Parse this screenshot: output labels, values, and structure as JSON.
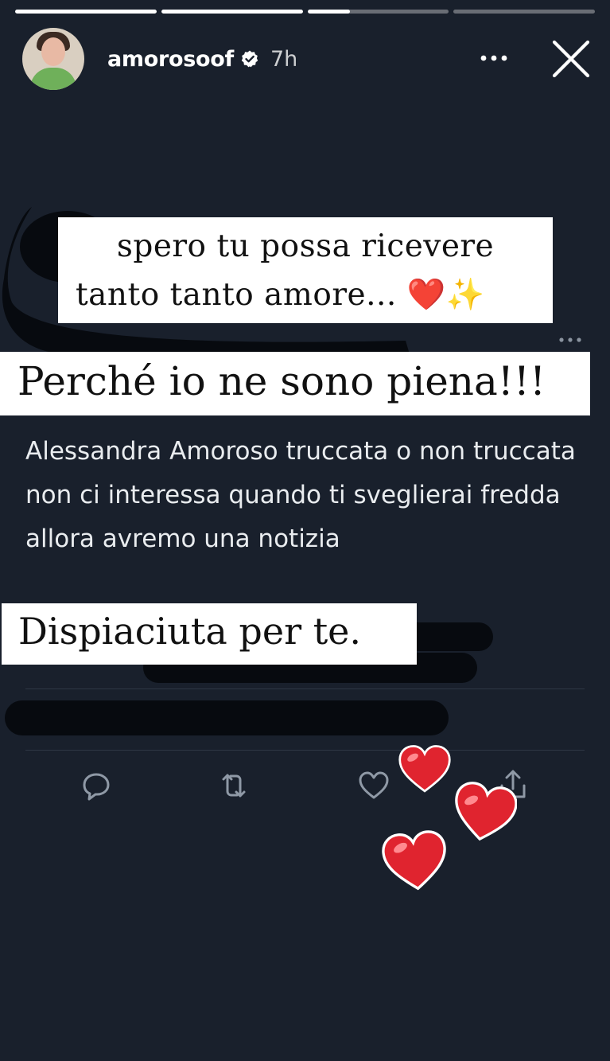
{
  "story": {
    "progress": [
      1,
      1,
      0.3,
      0
    ],
    "username": "amorosoof",
    "time": "7h",
    "icons": {
      "avatar": "profile-avatar",
      "verified": "verified-badge-icon",
      "more": "more-options-icon",
      "close": "close-icon"
    }
  },
  "stickers": {
    "caption_line1": "spero tu possa ricevere",
    "caption_line2": "tanto tanto amore...",
    "caption_emoji": "❤️✨",
    "headline": "Perché io ne sono piena!!!",
    "footer": "Dispiaciuta per te."
  },
  "tweet": {
    "text": "Alessandra Amoroso truccata o non truccata non ci interessa quando ti sveglierai fredda allora avremo una notizia",
    "actions": [
      "reply-icon",
      "retweet-icon",
      "like-icon",
      "share-icon"
    ]
  },
  "colors": {
    "background": "#19202c",
    "heart": "#e0242f",
    "redaction": "#070a0f"
  }
}
